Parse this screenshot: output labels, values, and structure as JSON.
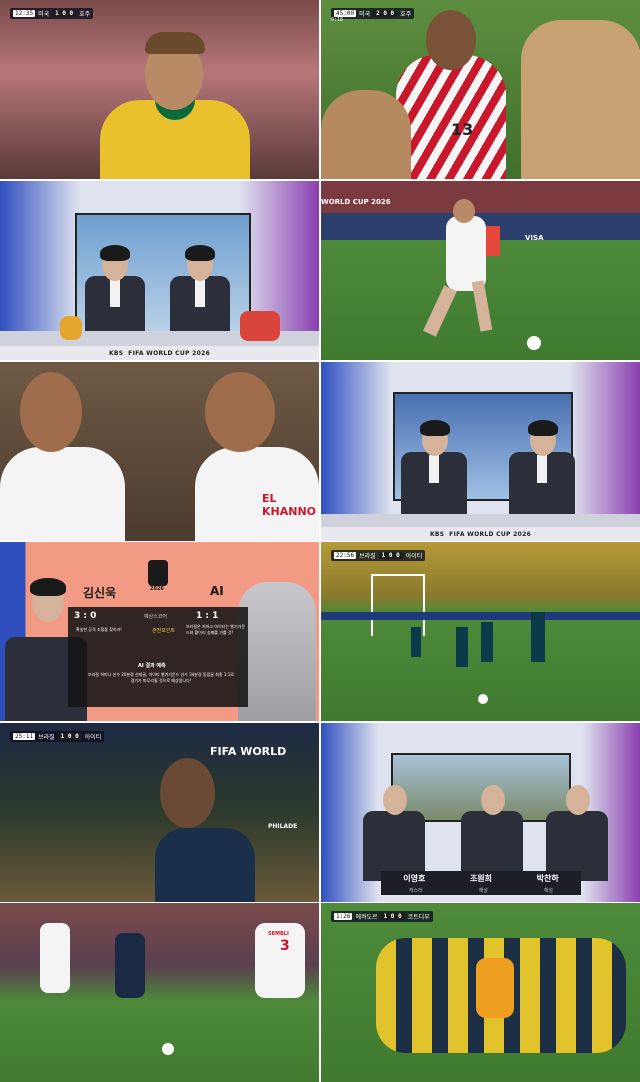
{
  "tiles": [
    {
      "id": "t1",
      "bug": {
        "time": "12:35",
        "home": "미국",
        "score": "1 0 0",
        "away": "호주"
      }
    },
    {
      "id": "t2",
      "bug": {
        "time": "45:00",
        "extra": "0:18",
        "home": "미국",
        "score": "2 0 0",
        "away": "호주"
      },
      "jersey_number": "13"
    },
    {
      "id": "t3",
      "broadcaster": "KBS",
      "tournament": "FIFA WORLD CUP 2026"
    },
    {
      "id": "t4",
      "banner": "WORLD CUP 2026",
      "board": "VISA"
    },
    {
      "id": "t5",
      "shirt_name": "EL KHANNO"
    },
    {
      "id": "t6",
      "broadcaster": "KBS",
      "tournament": "FIFA WORLD CUP 2026"
    },
    {
      "id": "t7",
      "left_name": "김신욱",
      "right_name": "AI",
      "left_pred": "3 : 0",
      "left_label": "예상스코어",
      "right_pred": "1 : 1",
      "left_point_label": "관전포인트",
      "left_point": "확실한 공격 조합을 찾아라!",
      "right_point": "브라질은 저하고 아이티는 벨기가운드와 황이리 승패를 가를 것!",
      "ai_title": "AI 결과 예측",
      "ai_text": "브라질 허피나 선수 20분경 선제골, 아이티 벨기가운드 선수 34분경 동점골 최종 1:1로 경기가 마무리될 것으로 예상됩니다!",
      "logo_year": "2026"
    },
    {
      "id": "t8",
      "bug": {
        "time": "22:56",
        "home": "브라질",
        "score": "1 0 0",
        "away": "아이티"
      }
    },
    {
      "id": "t9",
      "bug": {
        "time": "25:11",
        "home": "브라질",
        "score": "1 0 0",
        "away": "아이티"
      },
      "banner": "FIFA WORLD",
      "sub_banner": "PHILADE"
    },
    {
      "id": "t10",
      "names": [
        "이영호",
        "조원희",
        "박찬하"
      ],
      "roles": [
        "캐스터",
        "해설",
        "해설"
      ]
    },
    {
      "id": "t11",
      "numbers": [
        "3"
      ],
      "shirt_name": "SEMBLI"
    },
    {
      "id": "t12",
      "bug": {
        "time": "1:26",
        "home": "에콰도르",
        "score": "1 0 0",
        "away": "코트디부"
      }
    }
  ],
  "colors": {
    "pitch": "#4e8a3a",
    "studio_blue": "#2f4fbf",
    "studio_purple": "#8a3fb0",
    "brazil_yellow": "#e9c62b",
    "brazil_green": "#0b6b3a",
    "korea_red": "#c9182c",
    "salmon": "#f29a84"
  }
}
